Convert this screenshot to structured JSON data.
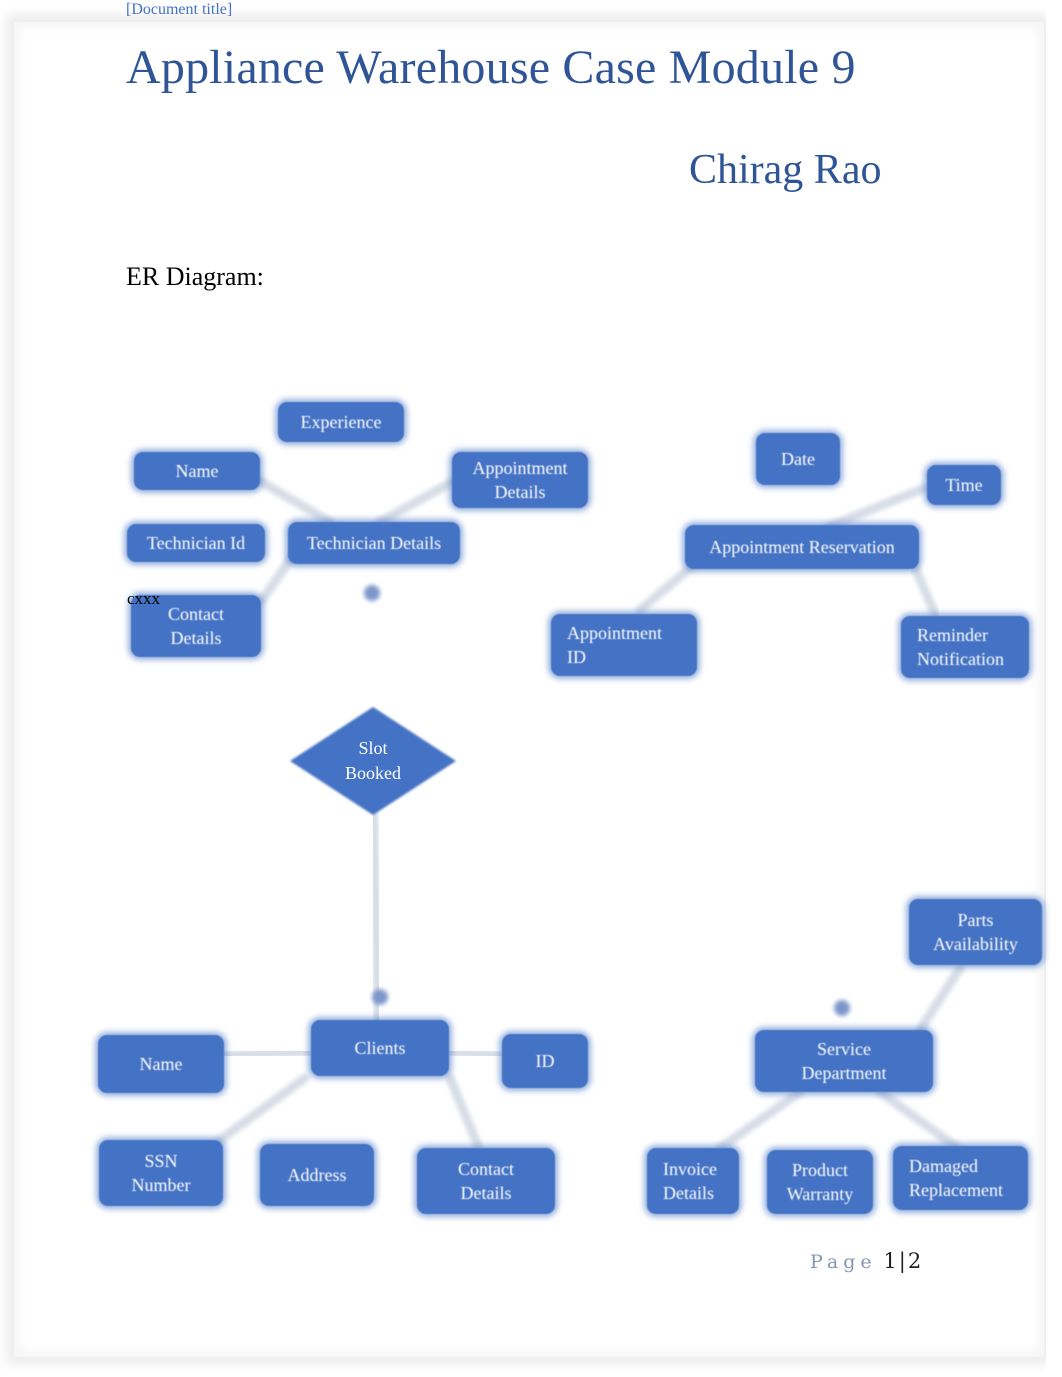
{
  "header": {
    "document_title_placeholder": "[Document title]"
  },
  "document": {
    "title": "Appliance Warehouse Case Module 9",
    "author": "Chirag Rao",
    "section_heading": "ER Diagram:",
    "stray_text": "cxxx"
  },
  "diagram": {
    "entities": {
      "technician_details": "Technician Details",
      "appointment_reservation": "Appointment Reservation",
      "clients": "Clients",
      "service_department": "Service Department"
    },
    "relationship": {
      "slot_booked": "Slot Booked"
    },
    "attributes": {
      "technician": {
        "experience": "Experience",
        "name": "Name",
        "appointment_details": "Appointment Details",
        "technician_id": "Technician Id",
        "contact_details": "Contact Details"
      },
      "appointment": {
        "date": "Date",
        "time": "Time",
        "appointment_id": "Appointment ID",
        "reminder_notification": "Reminder Notification"
      },
      "clients": {
        "name": "Name",
        "id": "ID",
        "ssn_number": "SSN Number",
        "address": "Address",
        "contact_details": "Contact Details"
      },
      "service": {
        "parts_availability": "Parts Availability",
        "invoice_details": "Invoice Details",
        "product_warranty": "Product Warranty",
        "damaged_replacement": "Damaged Replacement"
      }
    },
    "colors": {
      "node_fill": "#4472c4",
      "connector": "#d7dde6",
      "title": "#2f5597"
    }
  },
  "footer": {
    "page_word": "Page",
    "current_page": "1",
    "separator": "|",
    "total_pages": "2"
  }
}
